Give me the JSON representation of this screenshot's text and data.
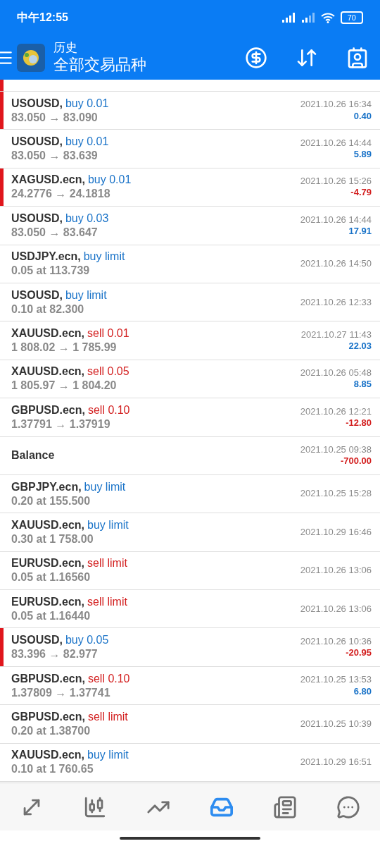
{
  "status_bar": {
    "time": "中午12:55",
    "battery": "70"
  },
  "app_bar": {
    "title": "历史",
    "subtitle": "全部交易品种"
  },
  "partial_row": {
    "marked": true
  },
  "deals": [
    {
      "symbol": "USOUSD,",
      "sell": false,
      "action": "buy 0.01",
      "prices": "83.050 → 83.090",
      "time": "2021.10.26 16:34",
      "profit": "0.40",
      "loss": false,
      "marked": true
    },
    {
      "symbol": "USOUSD,",
      "sell": false,
      "action": "buy 0.01",
      "prices": "83.050 → 83.639",
      "time": "2021.10.26 14:44",
      "profit": "5.89",
      "loss": false,
      "marked": false
    },
    {
      "symbol": "XAGUSD.ecn,",
      "sell": false,
      "action": "buy 0.01",
      "prices": "24.2776 → 24.1818",
      "time": "2021.10.26 15:26",
      "profit": "-4.79",
      "loss": true,
      "marked": true
    },
    {
      "symbol": "USOUSD,",
      "sell": false,
      "action": "buy 0.03",
      "prices": "83.050 → 83.647",
      "time": "2021.10.26 14:44",
      "profit": "17.91",
      "loss": false,
      "marked": false
    },
    {
      "symbol": "USDJPY.ecn,",
      "sell": false,
      "action": "buy limit",
      "prices": "0.05 at 113.739",
      "time": "2021.10.26 14:50",
      "marked": false
    },
    {
      "symbol": "USOUSD,",
      "sell": false,
      "action": "buy limit",
      "prices": "0.10 at 82.300",
      "time": "2021.10.26 12:33",
      "marked": false
    },
    {
      "symbol": "XAUUSD.ecn,",
      "sell": true,
      "action": "sell 0.01",
      "prices": "1 808.02 → 1 785.99",
      "time": "2021.10.27 11:43",
      "profit": "22.03",
      "loss": false,
      "marked": false
    },
    {
      "symbol": "XAUUSD.ecn,",
      "sell": true,
      "action": "sell 0.05",
      "prices": "1 805.97 → 1 804.20",
      "time": "2021.10.26 05:48",
      "profit": "8.85",
      "loss": false,
      "marked": false
    },
    {
      "symbol": "GBPUSD.ecn,",
      "sell": true,
      "action": "sell 0.10",
      "prices": "1.37791 → 1.37919",
      "time": "2021.10.26 12:21",
      "profit": "-12.80",
      "loss": true,
      "marked": false
    },
    {
      "symbol": "Balance",
      "time": "2021.10.25 09:38",
      "profit": "-700.00",
      "loss": true,
      "marked": false
    },
    {
      "symbol": "GBPJPY.ecn,",
      "sell": false,
      "action": "buy limit",
      "prices": "0.20 at 155.500",
      "time": "2021.10.25 15:28",
      "marked": false
    },
    {
      "symbol": "XAUUSD.ecn,",
      "sell": false,
      "action": "buy limit",
      "prices": "0.30 at 1 758.00",
      "time": "2021.10.29 16:46",
      "marked": false
    },
    {
      "symbol": "EURUSD.ecn,",
      "sell": true,
      "action": "sell limit",
      "prices": "0.05 at 1.16560",
      "time": "2021.10.26 13:06",
      "marked": false
    },
    {
      "symbol": "EURUSD.ecn,",
      "sell": true,
      "action": "sell limit",
      "prices": "0.05 at 1.16440",
      "time": "2021.10.26 13:06",
      "marked": false
    },
    {
      "symbol": "USOUSD,",
      "sell": false,
      "action": "buy 0.05",
      "prices": "83.396 → 82.977",
      "time": "2021.10.26 10:36",
      "profit": "-20.95",
      "loss": true,
      "marked": true
    },
    {
      "symbol": "GBPUSD.ecn,",
      "sell": true,
      "action": "sell 0.10",
      "prices": "1.37809 → 1.37741",
      "time": "2021.10.25 13:53",
      "profit": "6.80",
      "loss": false,
      "marked": false
    },
    {
      "symbol": "GBPUSD.ecn,",
      "sell": true,
      "action": "sell limit",
      "prices": "0.20 at 1.38700",
      "time": "2021.10.25 10:39",
      "marked": false
    },
    {
      "symbol": "XAUUSD.ecn,",
      "sell": false,
      "action": "buy limit",
      "prices": "0.10 at 1 760.65",
      "time": "2021.10.29 16:51",
      "marked": false
    }
  ],
  "nav": [
    {
      "kind": "quotes",
      "selected": false
    },
    {
      "kind": "chart",
      "selected": false
    },
    {
      "kind": "trade",
      "selected": false
    },
    {
      "kind": "history",
      "selected": true
    },
    {
      "kind": "news",
      "selected": false
    },
    {
      "kind": "chat",
      "selected": false
    }
  ]
}
